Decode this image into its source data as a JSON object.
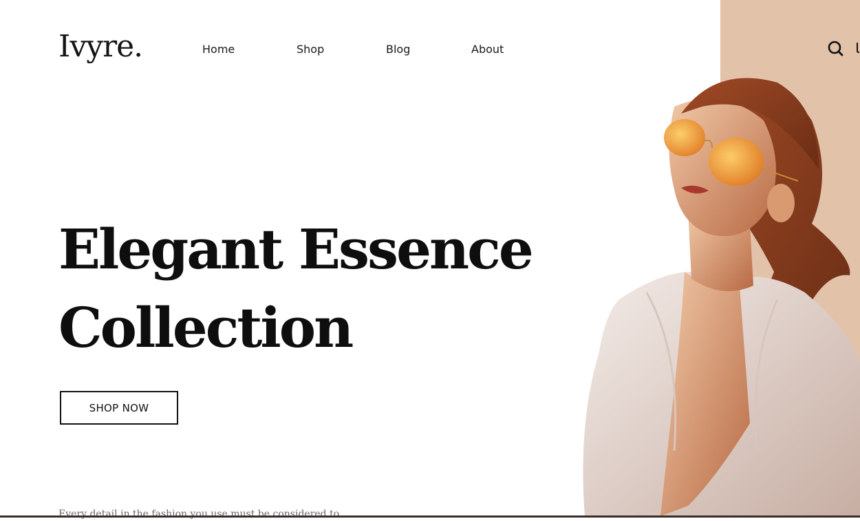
{
  "brand": {
    "logo": "Ivyre."
  },
  "nav": {
    "items": [
      {
        "label": "Home"
      },
      {
        "label": "Shop"
      },
      {
        "label": "Blog"
      },
      {
        "label": "About"
      }
    ]
  },
  "header_icons": [
    "search-icon",
    "cart-icon"
  ],
  "hero": {
    "title_line1": "Elegant Essence",
    "title_line2": "Collection",
    "cta_label": "SHOP NOW",
    "intro": "Every detail in the fashion you use must be considered to"
  },
  "colors": {
    "accent_panel": "#e3c2aa",
    "text": "#111111",
    "bottom_border": "#3a2a28"
  }
}
